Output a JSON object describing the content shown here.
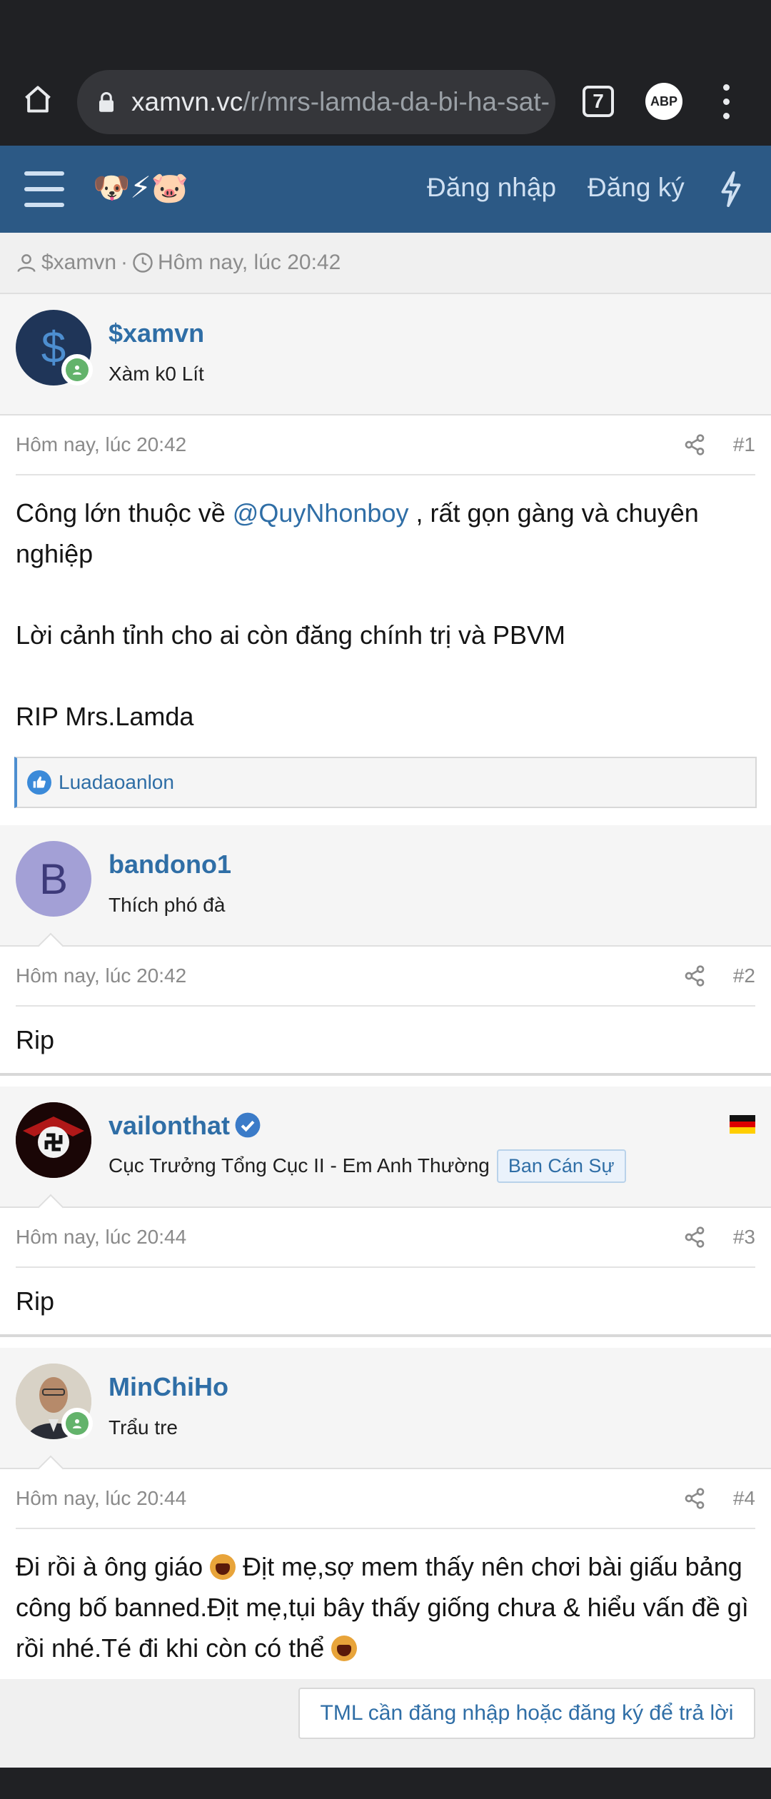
{
  "browser": {
    "url_host": "xamvn.vc",
    "url_path": "/r/mrs-lamda-da-bi-ha-sat-",
    "tab_count": "7",
    "abp_label": "ABP"
  },
  "site": {
    "logo_text": "🐶⚡🐷",
    "login_label": "Đăng nhập",
    "register_label": "Đăng ký"
  },
  "thread_meta": {
    "author": "$xamvn",
    "separator": "·",
    "time": "Hôm nay, lúc 20:42"
  },
  "posts": [
    {
      "username": "$xamvn",
      "user_title": "Xàm k0 Lít",
      "avatar_letter": "$",
      "date": "Hôm nay, lúc 20:42",
      "number": "#1",
      "body_line1_pre": "Công lớn thuộc về ",
      "mention": "@QuyNhonboy",
      "body_line1_post": " , rất gọn gàng và chuyên nghiệp",
      "body_line2": "Lời cảnh tỉnh cho ai còn đăng chính trị và PBVM",
      "body_line3": "RIP Mrs.Lamda",
      "reaction_user": "Luadaoanlon"
    },
    {
      "username": "bandono1",
      "user_title": "Thích phó đà",
      "avatar_letter": "B",
      "date": "Hôm nay, lúc 20:42",
      "number": "#2",
      "body": "Rip"
    },
    {
      "username": "vailonthat",
      "user_title": "Cục Trưởng Tổng Cục II - Em Anh Thường",
      "badge": "Ban Cán Sự",
      "date": "Hôm nay, lúc 20:44",
      "number": "#3",
      "body": "Rip"
    },
    {
      "username": "MinChiHo",
      "user_title": "Trẩu tre",
      "date": "Hôm nay, lúc 20:44",
      "number": "#4",
      "body_part1": "Đi rồi à ông giáo ",
      "body_part2": " Địt mẹ,sợ mem thấy nên chơi bài giấu bảng công bố banned.Địt mẹ,tụi bây thấy giống chưa & hiểu vấn đề gì rồi nhé.Té đi khi còn có thể "
    }
  ],
  "reply_prompt": "TML cần đăng nhập hoặc đăng ký để trả lời",
  "colors": {
    "header_blue": "#2c5985",
    "link_blue": "#2f6ea6",
    "online_green": "#63b36b",
    "browser_dark": "#202124"
  },
  "icons": [
    "home-icon",
    "lock-icon",
    "tabs-icon",
    "adblock-icon",
    "more-vert-icon",
    "hamburger-icon",
    "bolt-icon",
    "user-icon",
    "clock-icon",
    "share-icon",
    "like-icon",
    "verified-icon",
    "flag-icon"
  ]
}
